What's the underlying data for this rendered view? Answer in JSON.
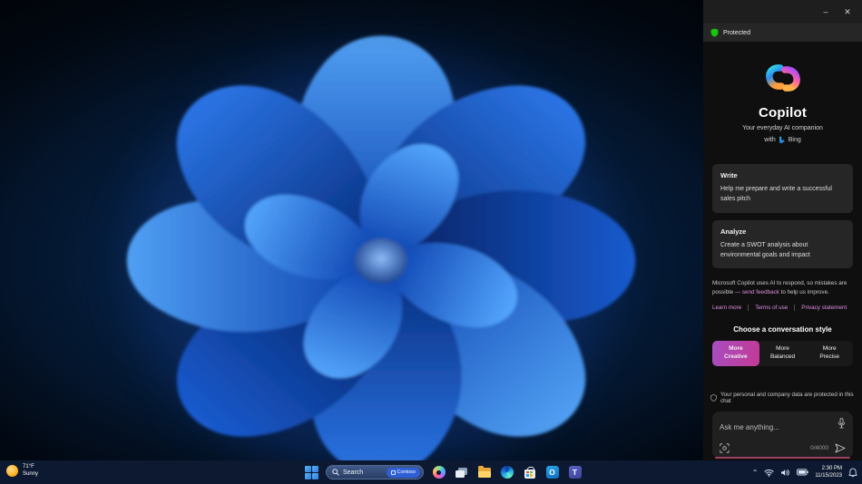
{
  "sidebar": {
    "window": {
      "minimize": "–",
      "close": "✕"
    },
    "protected_label": "Protected",
    "title": "Copilot",
    "subtitle": "Your everyday AI companion",
    "with_label": "with",
    "bing_label": "Bing",
    "cards": [
      {
        "title": "Write",
        "text": "Help me prepare and write a successful sales pitch"
      },
      {
        "title": "Analyze",
        "text": "Create a SWOT analysis about environmental goals and impact"
      }
    ],
    "disclaimer_prefix": "Microsoft Copilot uses AI to respond, so mistakes are possible ",
    "disclaimer_link": "— send feedback",
    "disclaimer_suffix": " to help us improve.",
    "links": [
      "Learn more",
      "Terms of use",
      "Privacy statement"
    ],
    "style_heading": "Choose a conversation style",
    "styles": [
      {
        "line1": "More",
        "line2": "Creative",
        "selected": true
      },
      {
        "line1": "More",
        "line2": "Balanced",
        "selected": false
      },
      {
        "line1": "More",
        "line2": "Precise",
        "selected": false
      }
    ],
    "privacy_note": "Your personal and company data are protected in this chat",
    "input": {
      "placeholder": "Ask me anything...",
      "counter": "0/4000"
    }
  },
  "taskbar": {
    "weather": {
      "temp": "71°F",
      "condition": "Sunny"
    },
    "search": {
      "label": "Search",
      "badge": "Contoso"
    },
    "apps": [
      {
        "name": "copilot"
      },
      {
        "name": "task-view"
      },
      {
        "name": "file-explorer"
      },
      {
        "name": "edge"
      },
      {
        "name": "microsoft-store"
      },
      {
        "name": "outlook",
        "glyph": "O"
      },
      {
        "name": "teams",
        "glyph": "T"
      }
    ],
    "tray": {
      "chevron": "⌃",
      "time": "2:30 PM",
      "date": "11/15/2023"
    }
  },
  "colors": {
    "creative_gradient_from": "#a84dc0",
    "creative_gradient_to": "#c23a96",
    "link_pink": "#de8ee2",
    "underline_pink": "#9e3f63",
    "protected_green": "#16c60c",
    "taskbar_bg": "#0d1930"
  }
}
